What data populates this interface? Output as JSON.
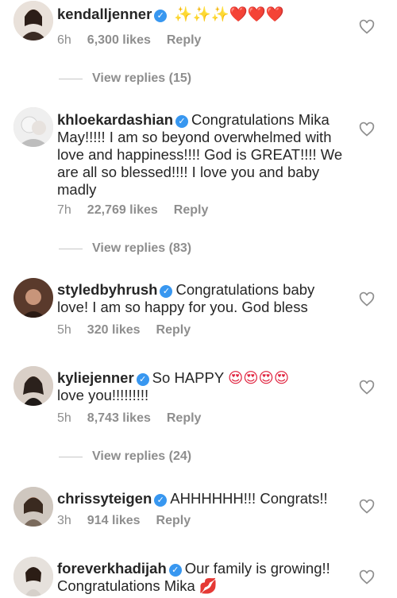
{
  "comments": [
    {
      "username": "kendalljenner",
      "text": "",
      "emoji": "✨✨✨❤️❤️❤️",
      "time": "6h",
      "likes": "6,300 likes",
      "reply": "Reply",
      "view_replies": "View replies (15)"
    },
    {
      "username": "khloekardashian",
      "text": "Congratulations Mika May!!!!! I am so beyond overwhelmed with love and happiness!!!! God is GREAT!!!! We are all so blessed!!!! I love you and baby madly",
      "time": "7h",
      "likes": "22,769 likes",
      "reply": "Reply",
      "view_replies": "View replies (83)"
    },
    {
      "username": "styledbyhrush",
      "text": "Congratulations baby love! I am so happy for you. God bless",
      "time": "5h",
      "likes": "320 likes",
      "reply": "Reply"
    },
    {
      "username": "kyliejenner",
      "text": "So HAPPY",
      "text2": "love you!!!!!!!!!",
      "emoji": "😍😍😍😍",
      "time": "5h",
      "likes": "8,743 likes",
      "reply": "Reply",
      "view_replies": "View replies (24)"
    },
    {
      "username": "chrissyteigen",
      "text": "AHHHHHH!!! Congrats!!",
      "time": "3h",
      "likes": "914 likes",
      "reply": "Reply"
    },
    {
      "username": "foreverkhadijah",
      "text": "Our family is growing!! Congratulations Mika",
      "emoji": "💋"
    }
  ],
  "icons": {
    "verified": "verified-badge-icon",
    "like": "heart-outline-icon"
  },
  "colors": {
    "verified": "#3897f0",
    "meta": "#8e8e8e",
    "text": "#262626"
  }
}
